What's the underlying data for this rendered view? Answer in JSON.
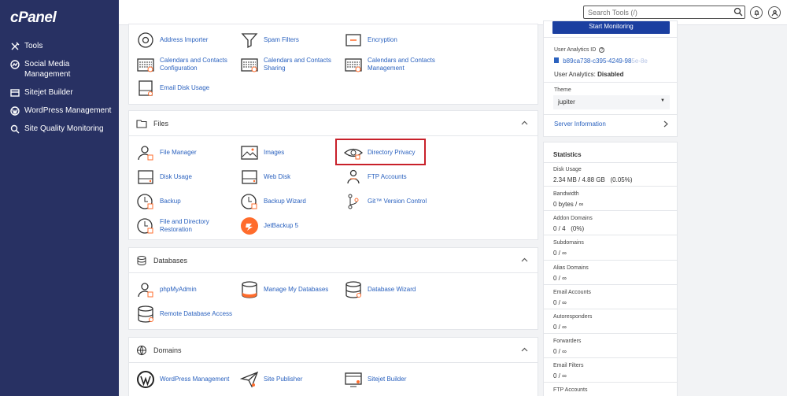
{
  "brand": "cPanel",
  "sidebar": {
    "items": [
      {
        "label": "Tools"
      },
      {
        "label": "Social Media Management"
      },
      {
        "label": "Sitejet Builder"
      },
      {
        "label": "WordPress Management"
      },
      {
        "label": "Site Quality Monitoring"
      }
    ]
  },
  "topbar": {
    "search_placeholder": "Search Tools (/)"
  },
  "email_tools": {
    "address_importer": "Address Importer",
    "spam_filters": "Spam Filters",
    "encryption": "Encryption",
    "cal_config": "Calendars and Contacts Configuration",
    "cal_sharing": "Calendars and Contacts Sharing",
    "cal_mgmt": "Calendars and Contacts Management",
    "email_disk": "Email Disk Usage"
  },
  "files": {
    "title": "Files",
    "tools": {
      "file_manager": "File Manager",
      "images": "Images",
      "directory_privacy": "Directory Privacy",
      "disk_usage": "Disk Usage",
      "web_disk": "Web Disk",
      "ftp_accounts": "FTP Accounts",
      "backup": "Backup",
      "backup_wizard": "Backup Wizard",
      "git": "Git™ Version Control",
      "file_restore": "File and Directory Restoration",
      "jetbackup": "JetBackup 5"
    }
  },
  "databases": {
    "title": "Databases",
    "tools": {
      "phpmyadmin": "phpMyAdmin",
      "manage_db": "Manage My Databases",
      "db_wizard": "Database Wizard",
      "remote_db": "Remote Database Access"
    }
  },
  "domains": {
    "title": "Domains",
    "tools": {
      "wp_mgmt": "WordPress Management",
      "site_publisher": "Site Publisher",
      "sitejet": "Sitejet Builder"
    }
  },
  "right": {
    "start_monitoring": "Start Monitoring",
    "analytics_id_label": "User Analytics ID",
    "analytics_id_value": "b89ca738-c395-4249-98",
    "analytics_id_faded": "5e-8e",
    "analytics_status_label": "User Analytics:",
    "analytics_status_value": "Disabled",
    "theme_label": "Theme",
    "theme_value": "jupiter",
    "server_info": "Server Information"
  },
  "statistics": {
    "title": "Statistics",
    "rows": [
      {
        "label": "Disk Usage",
        "value": "2.34 MB / 4.88 GB   (0.05%)"
      },
      {
        "label": "Bandwidth",
        "value": "0 bytes / ∞"
      },
      {
        "label": "Addon Domains",
        "value": "0 / 4   (0%)"
      },
      {
        "label": "Subdomains",
        "value": "0 / ∞"
      },
      {
        "label": "Alias Domains",
        "value": "0 / ∞"
      },
      {
        "label": "Email Accounts",
        "value": "0 / ∞"
      },
      {
        "label": "Autoresponders",
        "value": "0 / ∞"
      },
      {
        "label": "Forwarders",
        "value": "0 / ∞"
      },
      {
        "label": "Email Filters",
        "value": "0 / ∞"
      },
      {
        "label": "FTP Accounts",
        "value": ""
      }
    ]
  },
  "colors": {
    "sidebar": "#283163",
    "link": "#2b62bf",
    "accent": "#ff6c2c",
    "highlight": "#c8202a",
    "button": "#1b3fa0"
  }
}
